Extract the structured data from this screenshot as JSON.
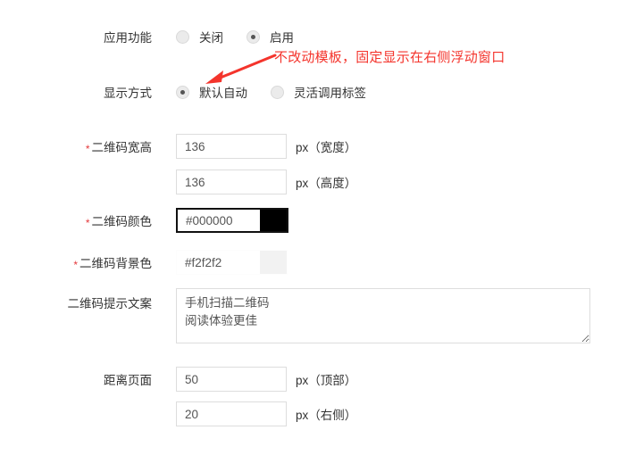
{
  "form": {
    "rows": [
      {
        "label": "应用功能",
        "required": false,
        "type": "radio",
        "options": [
          {
            "text": "关闭",
            "checked": false
          },
          {
            "text": "启用",
            "checked": true
          }
        ]
      },
      {
        "label": "显示方式",
        "required": false,
        "type": "radio",
        "options": [
          {
            "text": "默认自动",
            "checked": true
          },
          {
            "text": "灵活调用标签",
            "checked": false
          }
        ]
      }
    ],
    "qrcode_size": {
      "label": "二维码宽高",
      "required_mark": "*",
      "width_value": "136",
      "width_unit": "px（宽度）",
      "height_value": "136",
      "height_unit": "px（高度）"
    },
    "qrcode_color": {
      "label": "二维码颜色",
      "required_mark": "*",
      "value": "#000000",
      "swatch": "#000000"
    },
    "qrcode_bgcolor": {
      "label": "二维码背景色",
      "required_mark": "*",
      "value": "#f2f2f2",
      "swatch": "#f2f2f2"
    },
    "qrcode_tip": {
      "label": "二维码提示文案",
      "value": "手机扫描二维码\n阅读体验更佳"
    },
    "page_distance": {
      "label": "距离页面",
      "top_value": "50",
      "top_unit": "px（顶部）",
      "right_value": "20",
      "right_unit": "px（右侧）"
    }
  },
  "annotation": {
    "text": "不改动模板，固定显示在右侧浮动窗口",
    "color": "#f4342c"
  }
}
